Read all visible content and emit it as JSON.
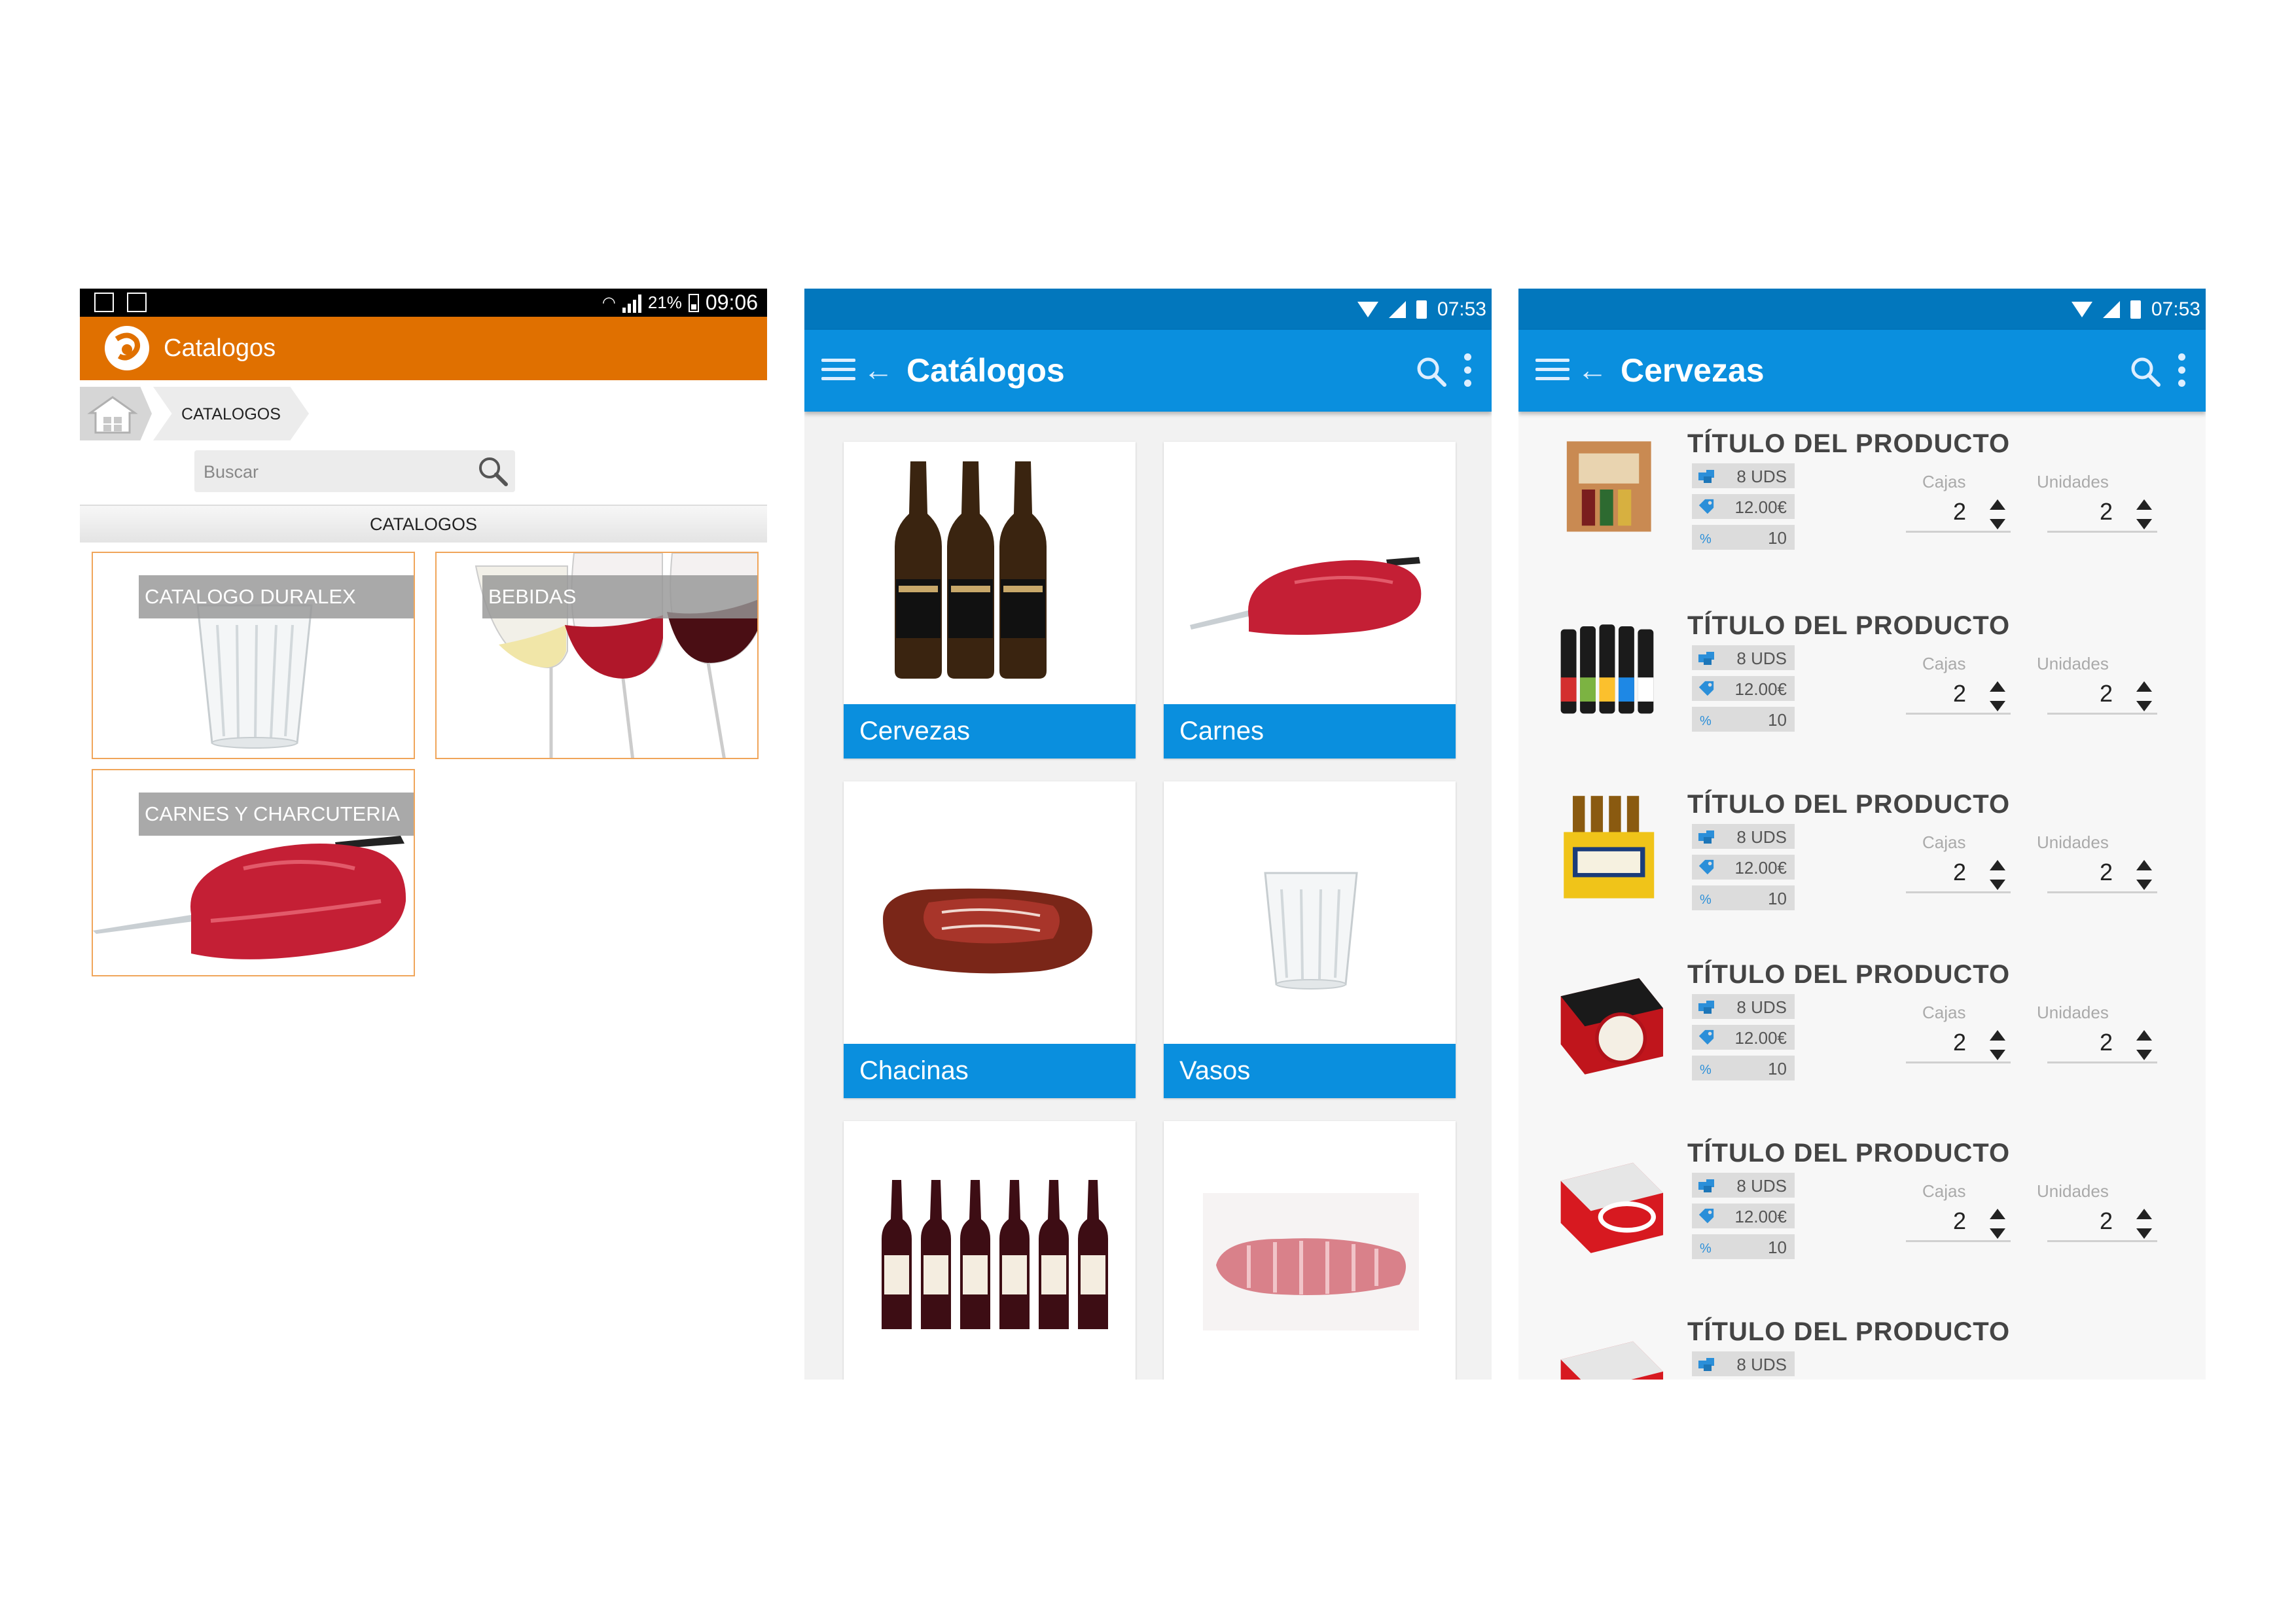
{
  "colors": {
    "orange_bar": "#e07000",
    "blue_bar": "#0a8fde",
    "blue_status": "#0277bd",
    "tile_border": "#f0a55a"
  },
  "phone1": {
    "status": {
      "battery_pct": "21%",
      "time": "09:06"
    },
    "app_title": "Catalogos",
    "breadcrumb": {
      "home_icon": "home-icon",
      "segment": "CATALOGOS"
    },
    "search_placeholder": "Buscar",
    "section_header": "CATALOGOS",
    "tiles": [
      {
        "label": "CATALOGO DURALEX",
        "image": "glass"
      },
      {
        "label": "BEBIDAS",
        "image": "wine-glasses"
      },
      {
        "label": "CARNES Y CHARCUTERIA",
        "image": "meat"
      }
    ]
  },
  "phone2": {
    "status": {
      "time": "07:53"
    },
    "title": "Catálogos",
    "cards": [
      {
        "label": "Cervezas",
        "image": "beer-bottles"
      },
      {
        "label": "Carnes",
        "image": "meat"
      },
      {
        "label": "Chacinas",
        "image": "ham"
      },
      {
        "label": "Vasos",
        "image": "glass"
      },
      {
        "label": "",
        "image": "wine-bottles"
      },
      {
        "label": "",
        "image": "ribs"
      }
    ]
  },
  "phone3": {
    "status": {
      "time": "07:53"
    },
    "title": "Cervezas",
    "labels": {
      "boxes": "Cajas",
      "units": "Unidades"
    },
    "products": [
      {
        "title": "TÍTULO DEL PRODUCTO",
        "units_per_box": "8 UDS",
        "price": "12.00€",
        "discount": "10",
        "boxes": "2",
        "units": "2",
        "image": "beer-case"
      },
      {
        "title": "TÍTULO DEL PRODUCTO",
        "units_per_box": "8 UDS",
        "price": "12.00€",
        "discount": "10",
        "boxes": "2",
        "units": "2",
        "image": "beer-bottles-colored"
      },
      {
        "title": "TÍTULO DEL PRODUCTO",
        "units_per_box": "8 UDS",
        "price": "12.00€",
        "discount": "10",
        "boxes": "2",
        "units": "2",
        "image": "corona-pack"
      },
      {
        "title": "TÍTULO DEL PRODUCTO",
        "units_per_box": "8 UDS",
        "price": "12.00€",
        "discount": "10",
        "boxes": "2",
        "units": "2",
        "image": "estrella-pack"
      },
      {
        "title": "TÍTULO DEL PRODUCTO",
        "units_per_box": "8 UDS",
        "price": "12.00€",
        "discount": "10",
        "boxes": "2",
        "units": "2",
        "image": "cruzcampo-pack"
      },
      {
        "title": "TÍTULO DEL PRODUCTO",
        "units_per_box": "8 UDS",
        "price": "",
        "discount": "",
        "boxes": "",
        "units": "",
        "image": "cruzcampo-pack"
      }
    ]
  }
}
